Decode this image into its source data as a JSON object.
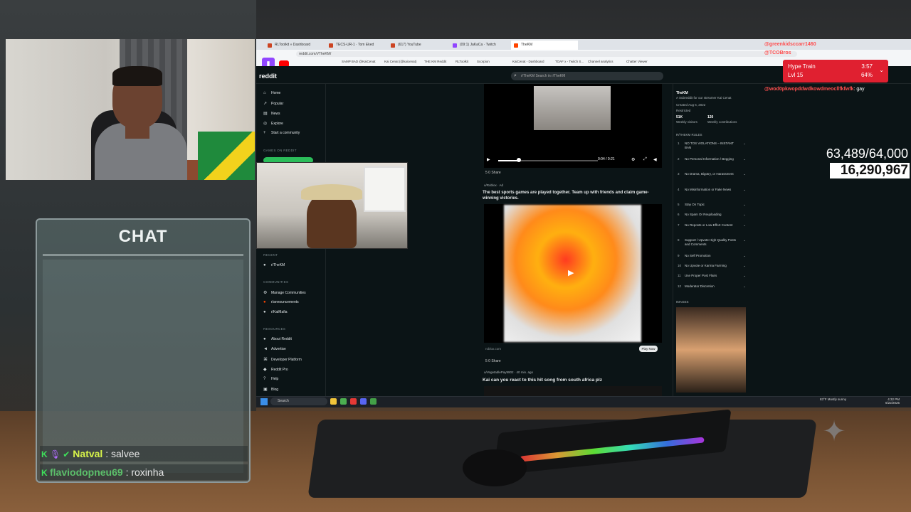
{
  "chat_panel": {
    "title": "CHAT",
    "messages": [
      {
        "user": "Natval",
        "text": ": salvee"
      },
      {
        "user": "flaviodopneu69",
        "text": ": roxinha"
      }
    ]
  },
  "browser": {
    "tabs": [
      "RLToolkit » Dashboard",
      "TECS-UR-1 · Tom Eked",
      "(617) YouTube",
      "(09:1) JaKaCa · Twitch",
      "TheKM"
    ],
    "url": "reddit.com/r/TheKM/",
    "bookmarks": [
      "SAMP BAD @KaiCenat",
      "Kai Cenat (@kaicenat)",
      "THE KM Reddit",
      "RLToolkit",
      "Scorpion",
      "KaiCenat - Dashboard",
      "TOAF x - Twitch S...",
      "Channel analytics",
      "Chatter Viewer"
    ]
  },
  "reddit": {
    "logo": "reddit",
    "search_placeholder": "r/TheKM  Search in r/TheKM",
    "nav": [
      "Home",
      "Popular",
      "News",
      "Explore",
      "Start a community"
    ],
    "games_heading": "GAMES ON REDDIT",
    "recent_heading": "RECENT",
    "recent_items": [
      "r/TheKM"
    ],
    "communities_heading": "COMMUNITIES",
    "communities": [
      "Manage Communities",
      "r/announcements",
      "r/KaiMafia"
    ],
    "resources_heading": "RESOURCES",
    "resources": [
      "About Reddit",
      "Advertise",
      "Developer Platform",
      "Reddit Pro",
      "Help",
      "Blog"
    ],
    "video_time": "0:04 / 0:21",
    "post1_actions": "5   0   Share",
    "ad_meta": "u/Roblox · Ad",
    "ad_title": "The best sports games are played together. Team up with friends and claim game-winning victories.",
    "ad_domain": "roblox.com",
    "play_now": "Play Now",
    "post2_actions": "5   0   Share",
    "post3_user": "u/VegetablePay9902 · 40 min. ago",
    "post3_title": "Kai can you react to this hit song from south africa plz",
    "subreddit": {
      "name": "TheKM",
      "description": "A Subreddit for our streamer Kai Cenat",
      "created": "Created Aug 6, 2022",
      "restricted": "Restricted",
      "weekly_visitors": "51K",
      "weekly_visitors_label": "Weekly visitors",
      "weekly_contributions": "120",
      "weekly_contributions_label": "Weekly contributions",
      "rules_heading": "R/THEKM RULES",
      "rules": [
        "NO TOS VIOLATIONS – INSTANT BAN",
        "No Personal Information / Begging",
        "No Drama, Bigotry, or Harassment",
        "No Misinformation or Fake News",
        "Stay On Topic",
        "No Spam Or Reuploading",
        "No Reposts or Low-Effort Content",
        "Support / Upvote High Quality Posts and Comments",
        "No Self Promotion",
        "No Upvote or Karma Farming",
        "Use Proper Post Flairs",
        "Moderator Discretion"
      ],
      "images_heading": "IMAGES"
    }
  },
  "taskbar": {
    "search": "Search",
    "weather": "83°F Mostly sunny",
    "time": "4:32 PM",
    "date": "6/22/2025"
  },
  "overlay": {
    "chat": [
      {
        "user": "@greenkidsccarr1460",
        "text": ""
      },
      {
        "user": "@TCOBros",
        "text": ""
      },
      {
        "user": "@wod0pkwopddwdkowdmeocllfkfwfk",
        "text": ": gay"
      }
    ],
    "hype_train": {
      "title": "Hype Train",
      "level": "Lvl 15",
      "time": "3:57",
      "percent": "64%",
      "progress": 0.64
    },
    "sub_goal": "63,489/64,000",
    "count": "16,290,967",
    "colors": {
      "hype": "#e02030",
      "chat_name": "#ff4f4f"
    }
  }
}
